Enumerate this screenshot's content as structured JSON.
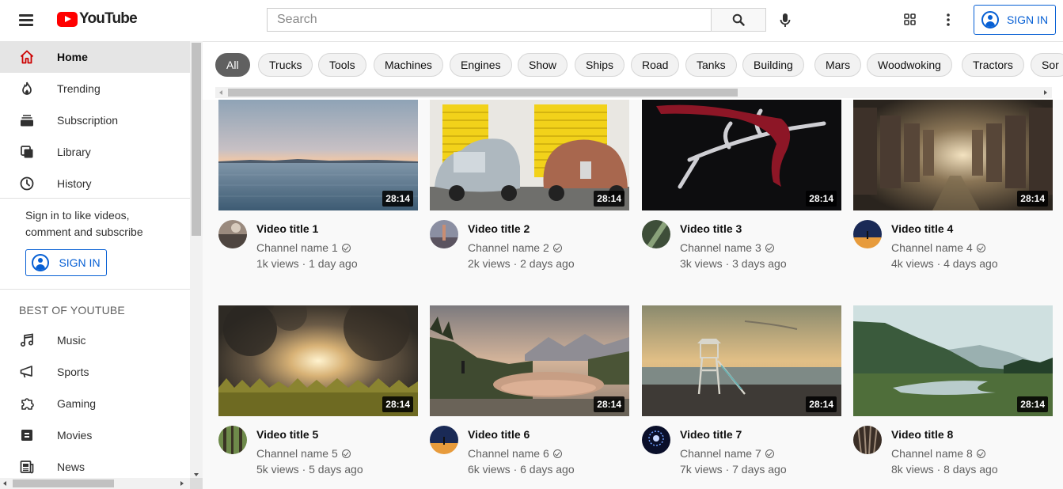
{
  "header": {
    "logo_text": "YouTube",
    "search_placeholder": "Search",
    "signin_label": "SIGN IN"
  },
  "sidebar": {
    "items": [
      {
        "label": "Home",
        "icon": "home-icon",
        "active": true
      },
      {
        "label": "Trending",
        "icon": "flame-icon"
      },
      {
        "label": "Subscription",
        "icon": "subscriptions-icon"
      },
      {
        "label": "Library",
        "icon": "library-icon"
      },
      {
        "label": "History",
        "icon": "history-icon"
      }
    ],
    "signin_prompt": "Sign in to like videos, comment and subscribe",
    "signin_label": "SIGN IN",
    "section_title": "BEST OF YOUTUBE",
    "best_items": [
      {
        "label": "Music",
        "icon": "music-icon"
      },
      {
        "label": "Sports",
        "icon": "sports-icon"
      },
      {
        "label": "Gaming",
        "icon": "gaming-icon"
      },
      {
        "label": "Movies",
        "icon": "movies-icon"
      },
      {
        "label": "News",
        "icon": "news-icon"
      }
    ]
  },
  "chips": [
    "All",
    "Trucks",
    "Tools",
    "Machines",
    "Engines",
    "Show",
    "Ships",
    "Road",
    "Tanks",
    "Building",
    "Mars",
    "Woodwoking",
    "Tractors",
    "Sor"
  ],
  "videos": [
    {
      "title": "Video title 1",
      "channel": "Channel name 1",
      "meta": "1k views · 1 day ago",
      "duration": "28:14"
    },
    {
      "title": "Video title 2",
      "channel": "Channel name 2",
      "meta": "2k views · 2 days ago",
      "duration": "28:14"
    },
    {
      "title": "Video title 3",
      "channel": "Channel name 3",
      "meta": "3k views · 3 days ago",
      "duration": "28:14"
    },
    {
      "title": "Video title 4",
      "channel": "Channel name 4",
      "meta": "4k views · 4 days ago",
      "duration": "28:14"
    },
    {
      "title": "Video title 5",
      "channel": "Channel name 5",
      "meta": "5k views · 5 days ago",
      "duration": "28:14"
    },
    {
      "title": "Video title 6",
      "channel": "Channel name 6",
      "meta": "6k views · 6 days ago",
      "duration": "28:14"
    },
    {
      "title": "Video title 7",
      "channel": "Channel name 7",
      "meta": "7k views · 7 days ago",
      "duration": "28:14"
    },
    {
      "title": "Video title 8",
      "channel": "Channel name 8",
      "meta": "8k views · 8 days ago",
      "duration": "28:14"
    }
  ],
  "colors": {
    "accent": "#065fd4",
    "brand": "#ff0000",
    "chip_active": "#606060"
  }
}
